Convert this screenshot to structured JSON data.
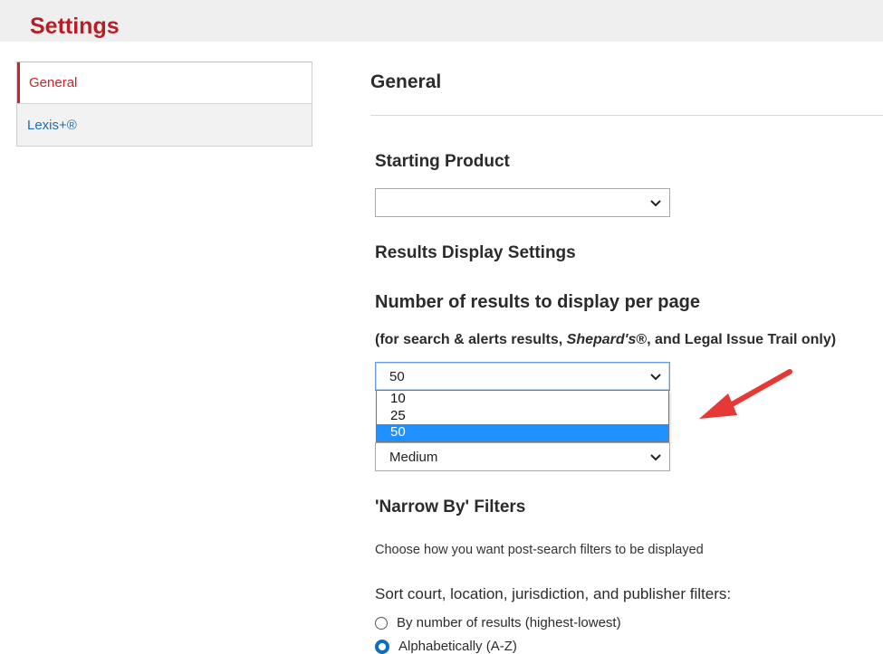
{
  "header": {
    "title": "Settings"
  },
  "sidebar": {
    "items": [
      {
        "label": "General",
        "active": true
      },
      {
        "label": "Lexis+®",
        "active": false
      }
    ]
  },
  "main": {
    "title": "General",
    "starting_product": {
      "heading": "Starting Product",
      "value": ""
    },
    "results_display": {
      "heading": "Results Display Settings",
      "per_page_heading": "Number of results to display per page",
      "note_prefix": "(for search & alerts results, ",
      "note_italic": "Shepard's",
      "note_suffix": "®, and Legal Issue Trail only)",
      "per_page_value": "50",
      "per_page_options": [
        "10",
        "25",
        "50"
      ],
      "per_page_selected_index": 2,
      "size_value": "Medium"
    },
    "narrow_by": {
      "heading": "'Narrow By' Filters",
      "description": "Choose how you want post-search filters to be displayed",
      "sort_label": "Sort court, location, jurisdiction, and publisher filters:",
      "options": [
        {
          "label": "By number of results (highest-lowest)",
          "checked": false
        },
        {
          "label": "Alphabetically (A-Z)",
          "checked": true
        }
      ]
    }
  },
  "colors": {
    "brand_red": "#b81e27",
    "link_blue": "#1a6fb5",
    "highlight_blue": "#1e90ff",
    "arrow_red": "#e53935"
  },
  "icons": {
    "dropdown": "chevron-down-icon",
    "annotation": "red-arrow-icon"
  }
}
